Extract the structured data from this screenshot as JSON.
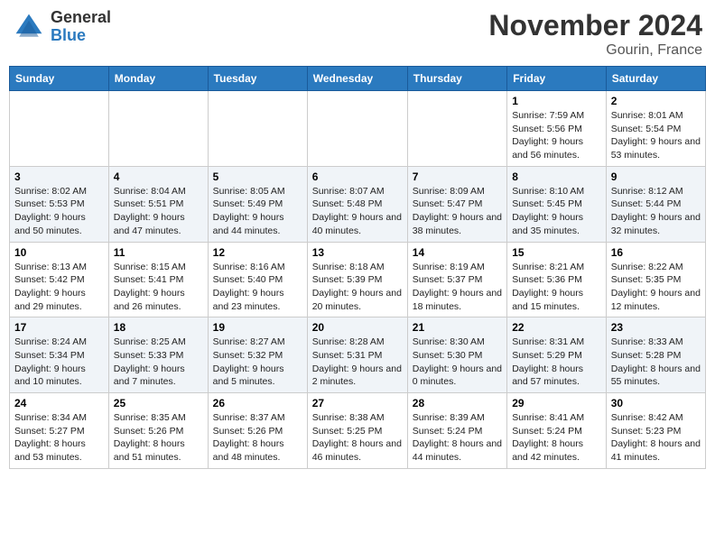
{
  "header": {
    "logo_line1": "General",
    "logo_line2": "Blue",
    "title": "November 2024",
    "subtitle": "Gourin, France"
  },
  "weekdays": [
    "Sunday",
    "Monday",
    "Tuesday",
    "Wednesday",
    "Thursday",
    "Friday",
    "Saturday"
  ],
  "weeks": [
    [
      {
        "day": "",
        "info": ""
      },
      {
        "day": "",
        "info": ""
      },
      {
        "day": "",
        "info": ""
      },
      {
        "day": "",
        "info": ""
      },
      {
        "day": "",
        "info": ""
      },
      {
        "day": "1",
        "info": "Sunrise: 7:59 AM\nSunset: 5:56 PM\nDaylight: 9 hours and 56 minutes."
      },
      {
        "day": "2",
        "info": "Sunrise: 8:01 AM\nSunset: 5:54 PM\nDaylight: 9 hours and 53 minutes."
      }
    ],
    [
      {
        "day": "3",
        "info": "Sunrise: 8:02 AM\nSunset: 5:53 PM\nDaylight: 9 hours and 50 minutes."
      },
      {
        "day": "4",
        "info": "Sunrise: 8:04 AM\nSunset: 5:51 PM\nDaylight: 9 hours and 47 minutes."
      },
      {
        "day": "5",
        "info": "Sunrise: 8:05 AM\nSunset: 5:49 PM\nDaylight: 9 hours and 44 minutes."
      },
      {
        "day": "6",
        "info": "Sunrise: 8:07 AM\nSunset: 5:48 PM\nDaylight: 9 hours and 40 minutes."
      },
      {
        "day": "7",
        "info": "Sunrise: 8:09 AM\nSunset: 5:47 PM\nDaylight: 9 hours and 38 minutes."
      },
      {
        "day": "8",
        "info": "Sunrise: 8:10 AM\nSunset: 5:45 PM\nDaylight: 9 hours and 35 minutes."
      },
      {
        "day": "9",
        "info": "Sunrise: 8:12 AM\nSunset: 5:44 PM\nDaylight: 9 hours and 32 minutes."
      }
    ],
    [
      {
        "day": "10",
        "info": "Sunrise: 8:13 AM\nSunset: 5:42 PM\nDaylight: 9 hours and 29 minutes."
      },
      {
        "day": "11",
        "info": "Sunrise: 8:15 AM\nSunset: 5:41 PM\nDaylight: 9 hours and 26 minutes."
      },
      {
        "day": "12",
        "info": "Sunrise: 8:16 AM\nSunset: 5:40 PM\nDaylight: 9 hours and 23 minutes."
      },
      {
        "day": "13",
        "info": "Sunrise: 8:18 AM\nSunset: 5:39 PM\nDaylight: 9 hours and 20 minutes."
      },
      {
        "day": "14",
        "info": "Sunrise: 8:19 AM\nSunset: 5:37 PM\nDaylight: 9 hours and 18 minutes."
      },
      {
        "day": "15",
        "info": "Sunrise: 8:21 AM\nSunset: 5:36 PM\nDaylight: 9 hours and 15 minutes."
      },
      {
        "day": "16",
        "info": "Sunrise: 8:22 AM\nSunset: 5:35 PM\nDaylight: 9 hours and 12 minutes."
      }
    ],
    [
      {
        "day": "17",
        "info": "Sunrise: 8:24 AM\nSunset: 5:34 PM\nDaylight: 9 hours and 10 minutes."
      },
      {
        "day": "18",
        "info": "Sunrise: 8:25 AM\nSunset: 5:33 PM\nDaylight: 9 hours and 7 minutes."
      },
      {
        "day": "19",
        "info": "Sunrise: 8:27 AM\nSunset: 5:32 PM\nDaylight: 9 hours and 5 minutes."
      },
      {
        "day": "20",
        "info": "Sunrise: 8:28 AM\nSunset: 5:31 PM\nDaylight: 9 hours and 2 minutes."
      },
      {
        "day": "21",
        "info": "Sunrise: 8:30 AM\nSunset: 5:30 PM\nDaylight: 9 hours and 0 minutes."
      },
      {
        "day": "22",
        "info": "Sunrise: 8:31 AM\nSunset: 5:29 PM\nDaylight: 8 hours and 57 minutes."
      },
      {
        "day": "23",
        "info": "Sunrise: 8:33 AM\nSunset: 5:28 PM\nDaylight: 8 hours and 55 minutes."
      }
    ],
    [
      {
        "day": "24",
        "info": "Sunrise: 8:34 AM\nSunset: 5:27 PM\nDaylight: 8 hours and 53 minutes."
      },
      {
        "day": "25",
        "info": "Sunrise: 8:35 AM\nSunset: 5:26 PM\nDaylight: 8 hours and 51 minutes."
      },
      {
        "day": "26",
        "info": "Sunrise: 8:37 AM\nSunset: 5:26 PM\nDaylight: 8 hours and 48 minutes."
      },
      {
        "day": "27",
        "info": "Sunrise: 8:38 AM\nSunset: 5:25 PM\nDaylight: 8 hours and 46 minutes."
      },
      {
        "day": "28",
        "info": "Sunrise: 8:39 AM\nSunset: 5:24 PM\nDaylight: 8 hours and 44 minutes."
      },
      {
        "day": "29",
        "info": "Sunrise: 8:41 AM\nSunset: 5:24 PM\nDaylight: 8 hours and 42 minutes."
      },
      {
        "day": "30",
        "info": "Sunrise: 8:42 AM\nSunset: 5:23 PM\nDaylight: 8 hours and 41 minutes."
      }
    ]
  ]
}
